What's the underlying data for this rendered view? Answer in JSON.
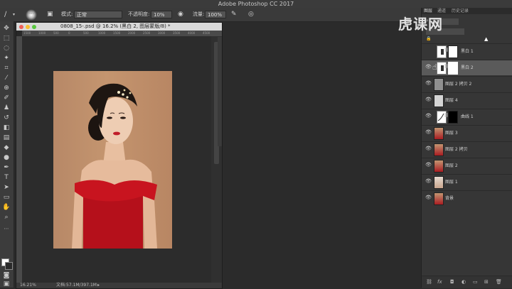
{
  "app": {
    "title": "Adobe Photoshop CC 2017"
  },
  "options_bar": {
    "brush_size": "300",
    "mode_label": "模式:",
    "mode_value": "正常",
    "opacity_label": "不透明度:",
    "opacity_value": "10%",
    "flow_label": "流量:",
    "flow_value": "100%"
  },
  "document": {
    "tab_title": "0808_15-.psd @ 16.2% (黑白 2, 图层蒙版/8) *",
    "zoom": "16.21%",
    "doc_size": "文档:57.1M/397.1M",
    "ruler_ticks": [
      "1500",
      "1000",
      "500",
      "0",
      "500",
      "1000",
      "1500",
      "2000",
      "2500",
      "3000",
      "3500",
      "4000",
      "4500"
    ]
  },
  "panel": {
    "tabs": [
      "图层",
      "通道",
      "历史记录"
    ],
    "watermark": "虎课网",
    "layers": [
      {
        "name": "黑白 1",
        "eye": false,
        "type": "adjust",
        "selected": false
      },
      {
        "name": "黑白 2",
        "eye": true,
        "type": "adjust",
        "selected": true
      },
      {
        "name": "图层 2 拷贝 2",
        "eye": true,
        "type": "gray",
        "selected": false
      },
      {
        "name": "图层 4",
        "eye": true,
        "type": "gray",
        "selected": false
      },
      {
        "name": "曲线 1",
        "eye": true,
        "type": "curve",
        "selected": false
      },
      {
        "name": "图层 3",
        "eye": true,
        "type": "photo",
        "selected": false
      },
      {
        "name": "图层 2 拷贝",
        "eye": true,
        "type": "photo",
        "selected": false
      },
      {
        "name": "图层 2",
        "eye": true,
        "type": "photo",
        "selected": false
      },
      {
        "name": "图层 1",
        "eye": true,
        "type": "photo-light",
        "selected": false
      },
      {
        "name": "背景",
        "eye": true,
        "type": "photo",
        "selected": false
      }
    ],
    "bottom_icons": [
      "link-icon",
      "fx-icon",
      "mask-icon",
      "adjustment-icon",
      "group-icon",
      "new-layer-icon",
      "trash-icon"
    ],
    "fx_label": "fx"
  },
  "colors": {
    "selected_layer": "#5a5a5a",
    "panel_bg": "#363636",
    "canvas_bg": "#2c2c2c"
  }
}
